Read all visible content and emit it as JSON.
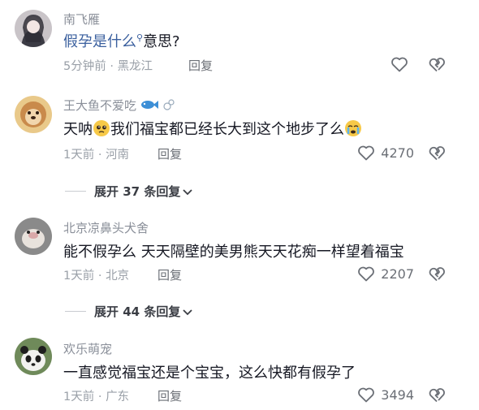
{
  "comments": [
    {
      "username": "南飞雁",
      "text_link": "假孕是什么",
      "text_rest": "意思?",
      "time": "5分钟前",
      "location": "黑龙江",
      "reply_label": "回复",
      "likes": ""
    },
    {
      "username": "王大鱼不爱吃",
      "text_part1": "天呐",
      "text_part2": "我们福宝都已经长大到这个地步了么",
      "time": "1天前",
      "location": "河南",
      "reply_label": "回复",
      "likes": "4270",
      "expand_label": "展开 37 条回复"
    },
    {
      "username": "北京凉鼻头犬舍",
      "text": "能不假孕么 天天隔壁的美男熊天天花痴一样望着福宝",
      "time": "1天前",
      "location": "北京",
      "reply_label": "回复",
      "likes": "2207",
      "expand_label": "展开 44 条回复"
    },
    {
      "username": "欢乐萌宠",
      "text": "一直感觉福宝还是个宝宝，这么快都有假孕了",
      "time": "1天前",
      "location": "广东",
      "reply_label": "回复",
      "likes": "3494"
    }
  ],
  "separator": "·",
  "colors": {
    "link": "#3a5f9e",
    "meta": "#9aa0a8",
    "text": "#161823"
  }
}
